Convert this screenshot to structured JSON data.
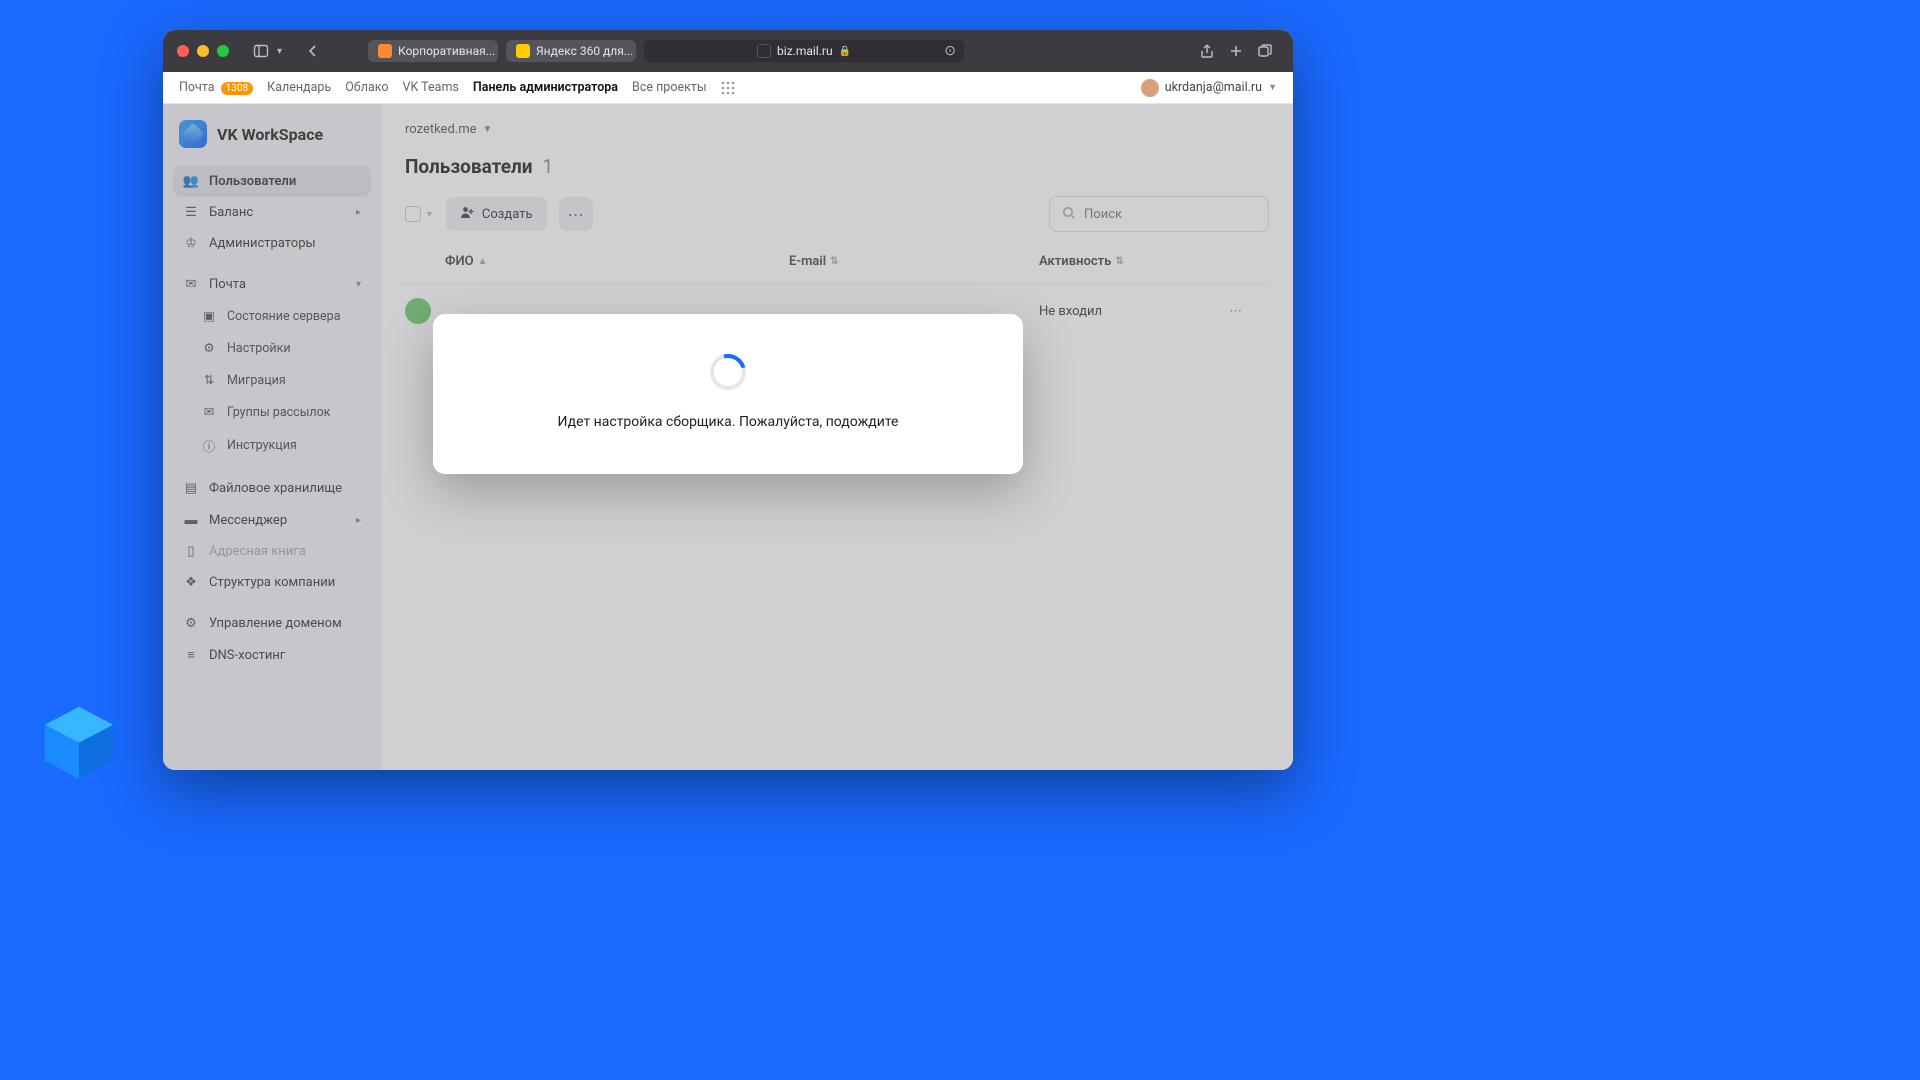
{
  "browser": {
    "tabs": [
      {
        "label": "Корпоративная...",
        "favicon": "#ff8a34"
      },
      {
        "label": "Яндекс 360 для...",
        "favicon": "#ffcc00"
      }
    ],
    "address": "biz.mail.ru"
  },
  "topnav": {
    "items": [
      {
        "label": "Почта",
        "badge": "1308"
      },
      {
        "label": "Календарь"
      },
      {
        "label": "Облако"
      },
      {
        "label": "VK Teams"
      },
      {
        "label": "Панель администратора",
        "active": true
      },
      {
        "label": "Все проекты"
      }
    ],
    "user_email": "ukrdanja@mail.ru"
  },
  "brand": {
    "title": "VK WorkSpace"
  },
  "domain_selector": "rozetked.me",
  "sidebar": {
    "users": "Пользователи",
    "balance": "Баланс",
    "admins": "Администраторы",
    "mail": "Почта",
    "mail_sub": {
      "server_status": "Состояние сервера",
      "settings": "Настройки",
      "migration": "Миграция",
      "groups": "Группы рассылок",
      "instruction": "Инструкция"
    },
    "storage": "Файловое хранилище",
    "messenger": "Мессенджер",
    "addressbook": "Адресная книга",
    "structure": "Структура компании",
    "domain_mgmt": "Управление доменом",
    "dns": "DNS-хостинг"
  },
  "page": {
    "title": "Пользователи",
    "count": "1",
    "create_label": "Создать",
    "search_placeholder": "Поиск",
    "columns": {
      "fio": "ФИО",
      "email": "E-mail",
      "activity": "Активность"
    },
    "rows": [
      {
        "activity": "Не входил"
      }
    ]
  },
  "modal": {
    "text": "Идет настройка сборщика. Пожалуйста, подождите"
  }
}
